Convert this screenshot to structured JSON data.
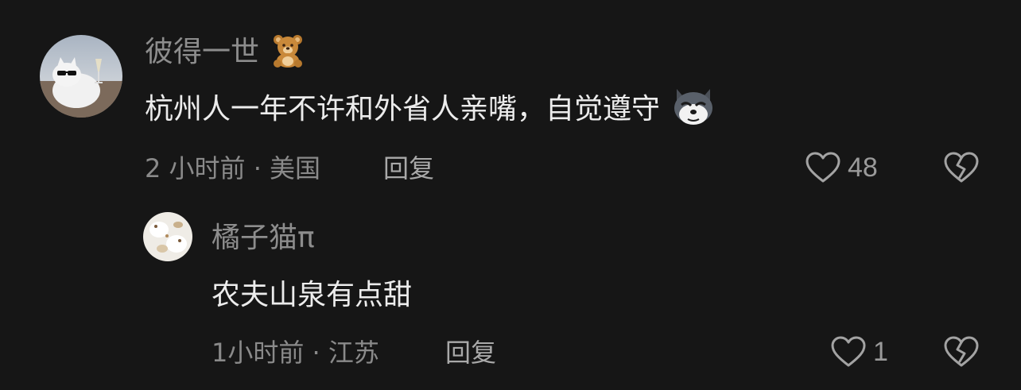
{
  "comments": [
    {
      "username": "彼得一世",
      "username_emoji": "bear-emoji",
      "text": "杭州人一年不许和外省人亲嘴，自觉遵守",
      "text_emoji": "wolf-dog-emoji",
      "meta": "2 小时前 · 美国",
      "reply_label": "回复",
      "like_count": "48",
      "avatar": "cat-with-sunglasses-avatar"
    },
    {
      "username": "橘子猫π",
      "text": "农夫山泉有点甜",
      "meta": "1小时前 · 江苏",
      "reply_label": "回复",
      "like_count": "1",
      "avatar": "cats-avatar"
    }
  ],
  "icons": {
    "like": "heart-outline-icon",
    "dislike": "broken-heart-icon"
  },
  "colors": {
    "background": "#161616",
    "username": "#8d8d8d",
    "text": "#ececec",
    "meta": "#8a8a8a"
  }
}
